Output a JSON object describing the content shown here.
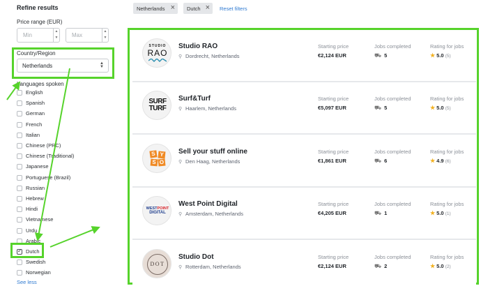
{
  "sidebar": {
    "title": "Refine results",
    "price_label": "Price range (EUR)",
    "min_placeholder": "Min",
    "max_placeholder": "Max",
    "country_label": "Country/Region",
    "country_value": "Netherlands",
    "languages_label": "Languages spoken",
    "languages": [
      {
        "label": "English",
        "checked": false
      },
      {
        "label": "Spanish",
        "checked": false
      },
      {
        "label": "German",
        "checked": false
      },
      {
        "label": "French",
        "checked": false
      },
      {
        "label": "Italian",
        "checked": false
      },
      {
        "label": "Chinese (PRC)",
        "checked": false
      },
      {
        "label": "Chinese (Traditional)",
        "checked": false
      },
      {
        "label": "Japanese",
        "checked": false
      },
      {
        "label": "Portuguese (Brazil)",
        "checked": false
      },
      {
        "label": "Russian",
        "checked": false
      },
      {
        "label": "Hebrew",
        "checked": false
      },
      {
        "label": "Hindi",
        "checked": false
      },
      {
        "label": "Vietnamese",
        "checked": false
      },
      {
        "label": "Urdu",
        "checked": false
      },
      {
        "label": "Arabic",
        "checked": false
      },
      {
        "label": "Dutch",
        "checked": true
      },
      {
        "label": "Swedish",
        "checked": false
      },
      {
        "label": "Norwegian",
        "checked": false
      }
    ],
    "see_less": "See less"
  },
  "filters": {
    "chips": [
      "Netherlands",
      "Dutch"
    ],
    "reset": "Reset filters"
  },
  "labels": {
    "starting_price": "Starting price",
    "jobs_completed": "Jobs completed",
    "rating": "Rating for jobs"
  },
  "results": [
    {
      "name": "Studio RAO",
      "location": "Dordrecht, Netherlands",
      "price": "€2,124 EUR",
      "jobs": "5",
      "rating": "5.0",
      "count": "(5)"
    },
    {
      "name": "Surf&Turf",
      "location": "Haarlem, Netherlands",
      "price": "€5,097 EUR",
      "jobs": "5",
      "rating": "5.0",
      "count": "(5)"
    },
    {
      "name": "Sell your stuff online",
      "location": "Den Haag, Netherlands",
      "price": "€1,861 EUR",
      "jobs": "6",
      "rating": "4.9",
      "count": "(6)"
    },
    {
      "name": "West Point Digital",
      "location": "Amsterdam, Netherlands",
      "price": "€4,205 EUR",
      "jobs": "1",
      "rating": "5.0",
      "count": "(1)"
    },
    {
      "name": "Studio Dot",
      "location": "Rotterdam, Netherlands",
      "price": "€2,124 EUR",
      "jobs": "2",
      "rating": "5.0",
      "count": "(2)"
    }
  ],
  "logos": {
    "rao": [
      "STUDIO",
      "RAO"
    ],
    "surf": [
      "SURF",
      "TURF"
    ],
    "sys": [
      "S",
      "Y",
      "S",
      "O"
    ],
    "wpd": [
      "WEST",
      "POINT",
      "DIGITAL"
    ],
    "dot": "DOT"
  },
  "colors": {
    "annotation_green": "#56d32b",
    "link_blue": "#2f7ad1",
    "star": "#f2b120",
    "sys_orange": "#f08a24",
    "wpd_blue": "#1d3c8c",
    "wpd_red": "#d8232a"
  }
}
